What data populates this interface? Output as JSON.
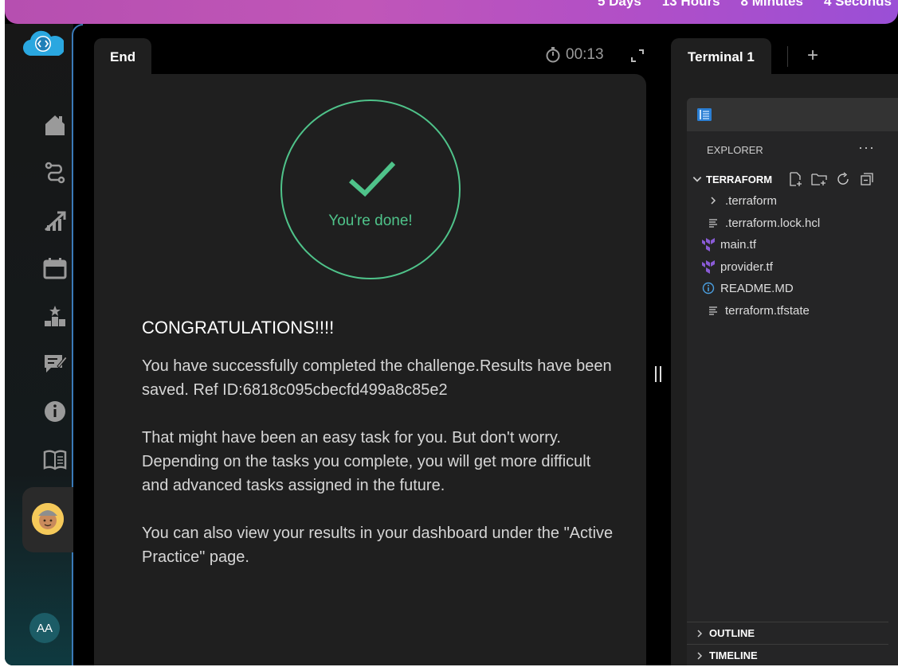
{
  "countdown": {
    "days": "5 Days",
    "hours": "13 Hours",
    "minutes": "8 Minutes",
    "seconds": "4 Seconds"
  },
  "colors": {
    "accent_green": "#4fc38a",
    "banner": "#c056b8",
    "panel": "#1f1f1f",
    "sidebar_avatar": "#1c5c66"
  },
  "sidebar": {
    "icons": [
      "home-icon",
      "route-icon",
      "growth-chart-icon",
      "calendar-icon",
      "leaderboard-icon",
      "feedback-icon",
      "info-icon",
      "book-icon",
      "video-icon"
    ],
    "user_initials": "AA"
  },
  "left_tab": {
    "label": "End",
    "timer": "00:13"
  },
  "result": {
    "status": "You're done!",
    "heading": "CONGRATULATIONS!!!!",
    "paragraphs": [
      "You have successfully completed the challenge.Results have been saved. Ref ID:6818c095cbecfd499a8c85e2",
      "That might have been an easy task for you. But don't worry. Depending on the tasks you complete, you will get more difficult and advanced tasks assigned in the future.",
      "You can also view your results in your dashboard under the \"Active Practice\" page."
    ]
  },
  "right_tab": {
    "label": "Terminal 1",
    "add": "+"
  },
  "explorer": {
    "title": "EXPLORER",
    "more": "···",
    "project": "TERRAFORM",
    "files": [
      {
        "name": ".terraform",
        "icon": "chevron-right-icon"
      },
      {
        "name": ".terraform.lock.hcl",
        "icon": "lines-icon"
      },
      {
        "name": "main.tf",
        "icon": "terraform-icon"
      },
      {
        "name": "provider.tf",
        "icon": "terraform-icon"
      },
      {
        "name": "README.MD",
        "icon": "info-icon"
      },
      {
        "name": "terraform.tfstate",
        "icon": "lines-icon"
      }
    ],
    "sections": [
      "OUTLINE",
      "TIMELINE"
    ]
  }
}
